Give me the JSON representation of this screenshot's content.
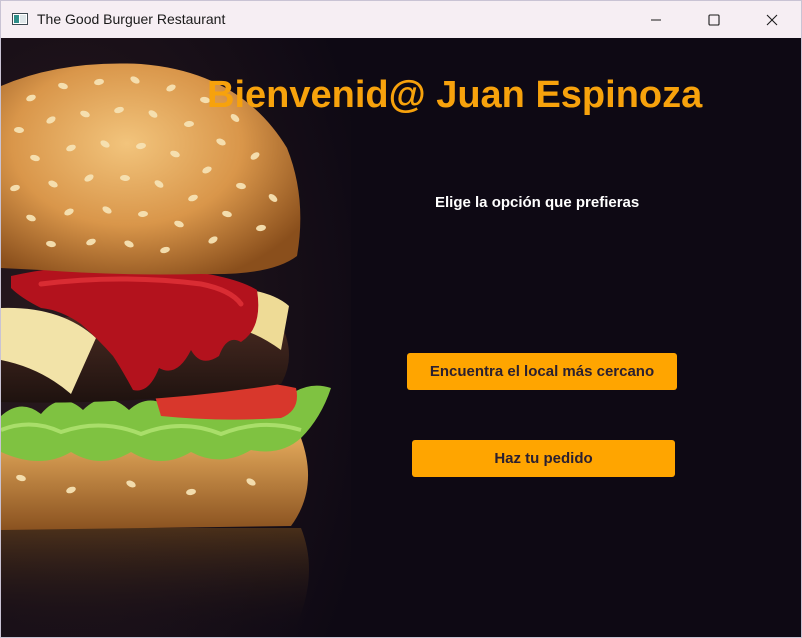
{
  "window": {
    "title": "The Good Burguer Restaurant",
    "app_icon": "window-app-icon",
    "controls": [
      "minimize-icon",
      "maximize-icon",
      "close-icon"
    ]
  },
  "main": {
    "heading": "Bienvenid@ Juan Espinoza",
    "subtitle": "Elige la opción que prefieras",
    "buttons": {
      "nearest_label": "Encuentra el local más cercano",
      "order_label": "Haz tu pedido"
    },
    "image": "burger-photo"
  },
  "colors": {
    "background": "#0e0914",
    "accent": "#ffa500",
    "heading": "#f7a20c",
    "subtitle": "#ffffff",
    "titlebar": "#f6eef3"
  }
}
